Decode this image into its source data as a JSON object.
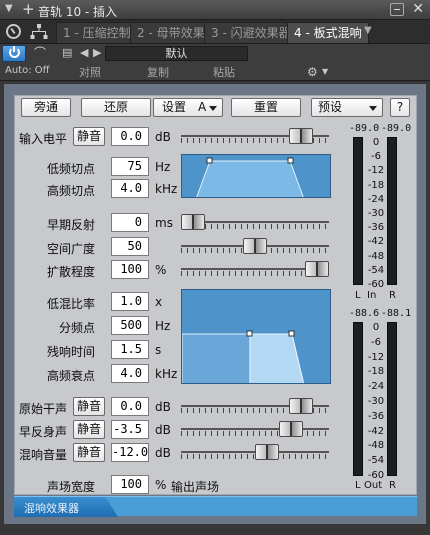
{
  "titlebar": {
    "title": "音轨 10 - 插入"
  },
  "tabs": [
    {
      "label": "1 - 压缩控制"
    },
    {
      "label": "2 - 母带效果"
    },
    {
      "label": "3 - 闪避效果器"
    },
    {
      "label": "4 - 板式混响"
    }
  ],
  "toolbar": {
    "auto_label": "Auto: Off",
    "preset_name": "默认",
    "compare_label": "对照",
    "copy_label": "复制",
    "paste_label": "粘贴"
  },
  "buttons": {
    "bypass": "旁通",
    "restore": "还原",
    "setup": "设置",
    "setup_value": "A",
    "reset": "重置",
    "preset": "预设",
    "help": "?"
  },
  "input_level": {
    "label": "输入电平",
    "mute": "静音",
    "value": "0.0",
    "unit": "dB",
    "slider_fraction": 0.87
  },
  "lowcut": {
    "label": "低频切点",
    "value": "75",
    "unit": "Hz"
  },
  "highcut": {
    "label": "高频切点",
    "value": "4.0",
    "unit": "kHz"
  },
  "early_reflect": {
    "label": "早期反射",
    "value": "0",
    "unit": "ms",
    "slider_fraction": 0.0
  },
  "width": {
    "label": "空间广度",
    "value": "50",
    "unit": "",
    "slider_fraction": 0.5
  },
  "diffusion": {
    "label": "扩散程度",
    "value": "100",
    "unit": "%",
    "slider_fraction": 1.0
  },
  "low_mix_ratio": {
    "label": "低混比率",
    "value": "1.0",
    "unit": "x"
  },
  "crossover": {
    "label": "分频点",
    "value": "500",
    "unit": "Hz"
  },
  "reverb_time": {
    "label": "残响时间",
    "value": "1.5",
    "unit": "s"
  },
  "high_decay": {
    "label": "高频衰点",
    "value": "4.0",
    "unit": "kHz"
  },
  "dry": {
    "label": "原始干声",
    "mute": "静音",
    "value": "0.0",
    "unit": "dB",
    "slider_fraction": 0.87
  },
  "early": {
    "label": "早反身声",
    "mute": "静音",
    "value": "-3.5",
    "unit": "dB",
    "slider_fraction": 0.79
  },
  "reverb_level": {
    "label": "混响音量",
    "mute": "静音",
    "value": "-12.0",
    "unit": "dB",
    "slider_fraction": 0.6
  },
  "stage_width": {
    "label": "声场宽度",
    "value": "100",
    "unit": "%",
    "suffix": "输出声场"
  },
  "meter_in": {
    "peak_l": "-89.0",
    "peak_r": "-89.0",
    "label_l": "L",
    "label_mid": "In",
    "label_r": "R"
  },
  "meter_out": {
    "peak_l": "-88.6",
    "peak_r": "-88.1",
    "label_l": "L",
    "label_mid": "Out",
    "label_r": "R"
  },
  "meter_scale": [
    "0",
    "-6",
    "-12",
    "-18",
    "-24",
    "-30",
    "-36",
    "-42",
    "-48",
    "-54",
    "-60"
  ],
  "footer": {
    "label": "混响效果器"
  },
  "colors": {
    "accent": "#4e93c9",
    "panel": "#c7c9cc",
    "power": "#3d8ad6"
  }
}
